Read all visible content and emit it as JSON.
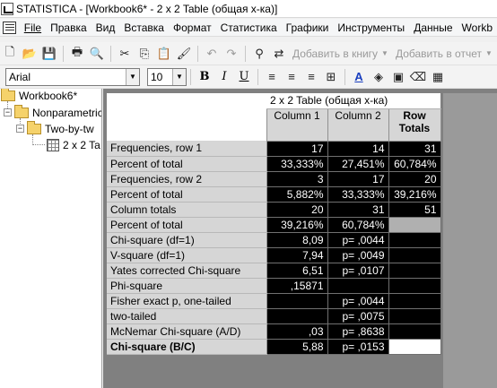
{
  "window": {
    "title": "STATISTICA - [Workbook6* - 2 x 2 Table (общая х-ка)]"
  },
  "menu": [
    "File",
    "Правка",
    "Вид",
    "Вставка",
    "Формат",
    "Статистика",
    "Графики",
    "Инструменты",
    "Данные",
    "Workb"
  ],
  "toolbar": {
    "add_to_workbook": "Добавить в книгу",
    "add_to_report": "Добавить в отчет",
    "font_name": "Arial",
    "font_size": "10",
    "bold": "B",
    "italic": "I",
    "underline": "U"
  },
  "tree": {
    "root": "Workbook6*",
    "level1": "Nonparametric",
    "level2": "Two-by-tw",
    "level3": "2 x 2 Ta"
  },
  "table": {
    "title": "2 x 2 Table (общая х-ка)",
    "columns": [
      "Column 1",
      "Column 2",
      "Row Totals"
    ],
    "rows": [
      {
        "label": "Frequencies, row 1",
        "c1": "17",
        "c2": "14",
        "c3": "31"
      },
      {
        "label": "Percent of total",
        "c1": "33,333%",
        "c2": "27,451%",
        "c3": "60,784%"
      },
      {
        "label": "Frequencies, row 2",
        "c1": "3",
        "c2": "17",
        "c3": "20"
      },
      {
        "label": "Percent of total",
        "c1": "5,882%",
        "c2": "33,333%",
        "c3": "39,216%"
      },
      {
        "label": "Column totals",
        "c1": "20",
        "c2": "31",
        "c3": "51"
      },
      {
        "label": "Percent of total",
        "c1": "39,216%",
        "c2": "60,784%",
        "c3": ""
      },
      {
        "label": "Chi-square (df=1)",
        "c1": "8,09",
        "c2": "p= ,0044",
        "c3": ""
      },
      {
        "label": "V-square (df=1)",
        "c1": "7,94",
        "c2": "p= ,0049",
        "c3": ""
      },
      {
        "label": "Yates corrected Chi-square",
        "c1": "6,51",
        "c2": "p= ,0107",
        "c3": ""
      },
      {
        "label": "Phi-square",
        "c1": ",15871",
        "c2": "",
        "c3": ""
      },
      {
        "label": "Fisher exact p, one-tailed",
        "c1": "",
        "c2": "p= ,0044",
        "c3": ""
      },
      {
        "label": "two-tailed",
        "c1": "",
        "c2": "p= ,0075",
        "c3": ""
      },
      {
        "label": "McNemar Chi-square (A/D)",
        "c1": ",03",
        "c2": "p= ,8638",
        "c3": ""
      },
      {
        "label": "Chi-square (B/C)",
        "c1": "5,88",
        "c2": "p= ,0153",
        "c3": ""
      }
    ]
  }
}
